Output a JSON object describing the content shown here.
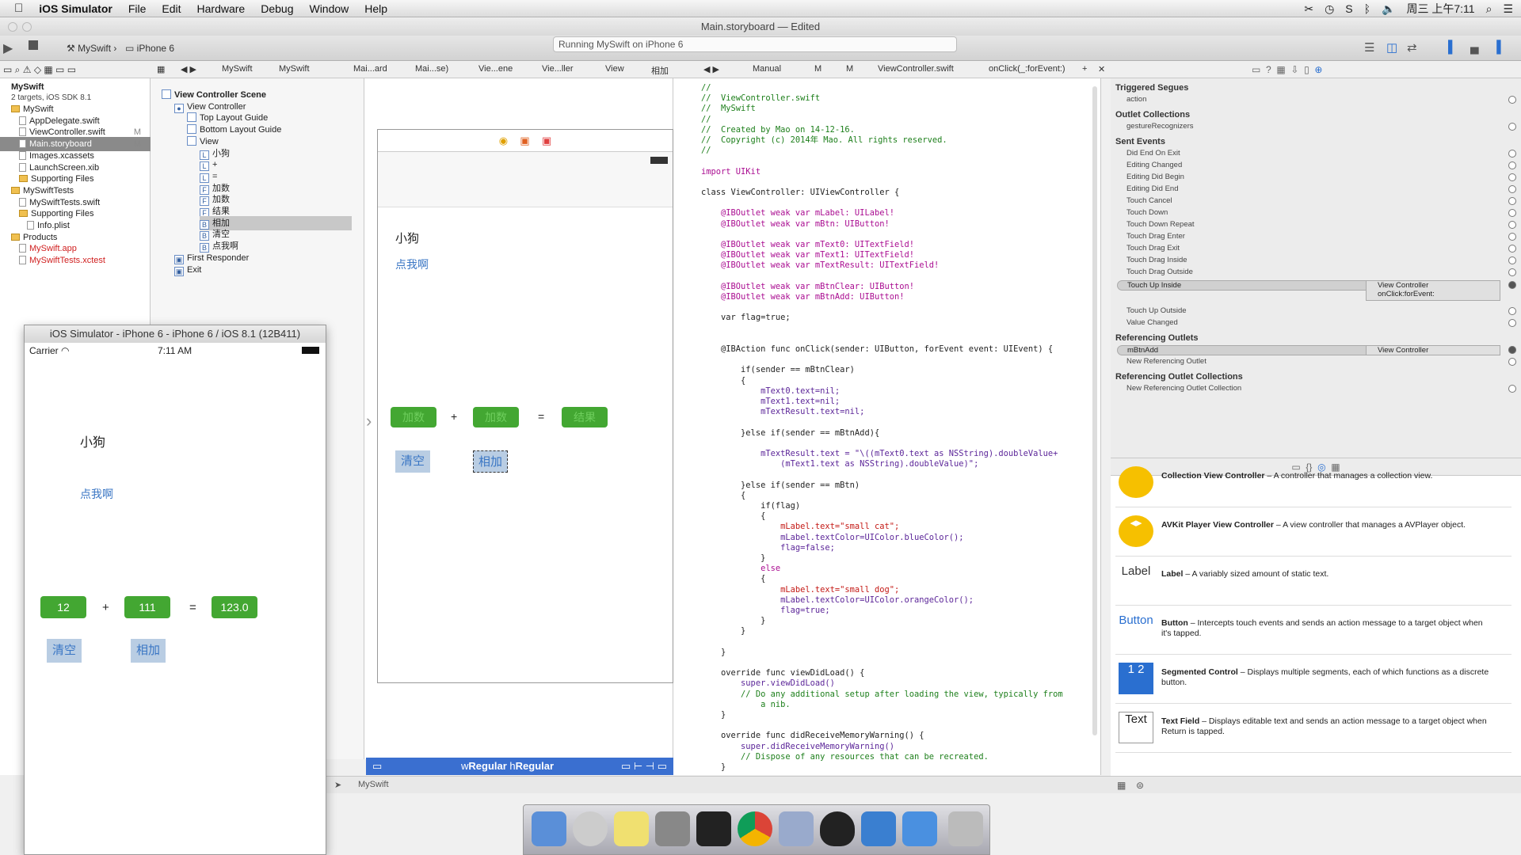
{
  "menubar": {
    "app": "iOS Simulator",
    "items": [
      "File",
      "Edit",
      "Hardware",
      "Debug",
      "Window",
      "Help"
    ],
    "clock": "周三 上午7:11"
  },
  "window": {
    "title": "Main.storyboard — Edited"
  },
  "toolbar": {
    "scheme": "MySwift",
    "device": "iPhone 6",
    "activity": "Running MySwift on iPhone 6"
  },
  "jumpbar": {
    "left": [
      "MySwift",
      "MySwift",
      "Mai...ard",
      "Mai...se)",
      "Vie...ene",
      "Vie...ller",
      "View",
      "相加"
    ],
    "right": [
      "Manual",
      "M",
      "M",
      "ViewController.swift",
      "onClick(_:forEvent:)"
    ]
  },
  "navigator": {
    "project": "MySwift",
    "project_sub": "2 targets, iOS SDK 8.1",
    "items": [
      {
        "label": "MySwift",
        "type": "folder",
        "indent": 1
      },
      {
        "label": "AppDelegate.swift",
        "type": "file",
        "indent": 2
      },
      {
        "label": "ViewController.swift",
        "type": "file",
        "indent": 2,
        "badge": "M"
      },
      {
        "label": "Main.storyboard",
        "type": "file",
        "indent": 2,
        "badge": "M",
        "selected": true
      },
      {
        "label": "Images.xcassets",
        "type": "file",
        "indent": 2
      },
      {
        "label": "LaunchScreen.xib",
        "type": "file",
        "indent": 2
      },
      {
        "label": "Supporting Files",
        "type": "folder",
        "indent": 2
      },
      {
        "label": "MySwiftTests",
        "type": "folder",
        "indent": 1
      },
      {
        "label": "MySwiftTests.swift",
        "type": "file",
        "indent": 2
      },
      {
        "label": "Supporting Files",
        "type": "folder",
        "indent": 2
      },
      {
        "label": "Info.plist",
        "type": "file",
        "indent": 3
      },
      {
        "label": "Products",
        "type": "folder",
        "indent": 1
      },
      {
        "label": "MySwift.app",
        "type": "file",
        "indent": 2,
        "red": true
      },
      {
        "label": "MySwiftTests.xctest",
        "type": "file",
        "indent": 2,
        "red": true
      }
    ],
    "filter": "MySwift"
  },
  "outline": {
    "items": [
      {
        "label": "View Controller Scene",
        "indent": 0,
        "bold": true,
        "icon": ""
      },
      {
        "label": "View Controller",
        "indent": 1,
        "icon": "●"
      },
      {
        "label": "Top Layout Guide",
        "indent": 2,
        "icon": ""
      },
      {
        "label": "Bottom Layout Guide",
        "indent": 2,
        "icon": ""
      },
      {
        "label": "View",
        "indent": 2,
        "icon": ""
      },
      {
        "label": "小狗",
        "indent": 3,
        "icon": "L"
      },
      {
        "label": "+",
        "indent": 3,
        "icon": "L"
      },
      {
        "label": "=",
        "indent": 3,
        "icon": "L"
      },
      {
        "label": "加数",
        "indent": 3,
        "icon": "F"
      },
      {
        "label": "加数",
        "indent": 3,
        "icon": "F"
      },
      {
        "label": "结果",
        "indent": 3,
        "icon": "F"
      },
      {
        "label": "相加",
        "indent": 3,
        "icon": "B",
        "selected": true
      },
      {
        "label": "清空",
        "indent": 3,
        "icon": "B"
      },
      {
        "label": "点我啊",
        "indent": 3,
        "icon": "B"
      },
      {
        "label": "First Responder",
        "indent": 1,
        "icon": "▣"
      },
      {
        "label": "Exit",
        "indent": 1,
        "icon": "▣"
      }
    ]
  },
  "storyboard": {
    "label": "小狗",
    "button": "点我啊",
    "field1": "加数",
    "plus": "+",
    "field2": "加数",
    "equals": "=",
    "field3": "结果",
    "clear": "清空",
    "add": "相加",
    "size_class": "wRegular hRegular",
    "w": "w",
    "h": "h",
    "size_w": "Regular",
    "size_h": "Regular"
  },
  "code": [
    {
      "t": "//",
      "c": "cm"
    },
    {
      "t": "//  ViewController.swift",
      "c": "cm"
    },
    {
      "t": "//  MySwift",
      "c": "cm"
    },
    {
      "t": "//",
      "c": "cm"
    },
    {
      "t": "//  Created by Mao on 14-12-16.",
      "c": "cm"
    },
    {
      "t": "//  Copyright (c) 2014年 Mao. All rights reserved.",
      "c": "cm"
    },
    {
      "t": "//",
      "c": "cm"
    },
    {
      "t": "",
      "c": ""
    },
    {
      "t": "import UIKit",
      "c": "kw"
    },
    {
      "t": "",
      "c": ""
    },
    {
      "t": "class ViewController: UIViewController {",
      "c": ""
    },
    {
      "t": "",
      "c": ""
    },
    {
      "t": "    @IBOutlet weak var mLabel: UILabel!",
      "c": "kw"
    },
    {
      "t": "    @IBOutlet weak var mBtn: UIButton!",
      "c": "kw"
    },
    {
      "t": "",
      "c": ""
    },
    {
      "t": "    @IBOutlet weak var mText0: UITextField!",
      "c": "kw"
    },
    {
      "t": "    @IBOutlet weak var mText1: UITextField!",
      "c": "kw"
    },
    {
      "t": "    @IBOutlet weak var mTextResult: UITextField!",
      "c": "kw"
    },
    {
      "t": "",
      "c": ""
    },
    {
      "t": "    @IBOutlet weak var mBtnClear: UIButton!",
      "c": "kw"
    },
    {
      "t": "    @IBOutlet weak var mBtnAdd: UIButton!",
      "c": "kw"
    },
    {
      "t": "",
      "c": ""
    },
    {
      "t": "    var flag=true;",
      "c": ""
    },
    {
      "t": "",
      "c": ""
    },
    {
      "t": "",
      "c": ""
    },
    {
      "t": "    @IBAction func onClick(sender: UIButton, forEvent event: UIEvent) {",
      "c": ""
    },
    {
      "t": "",
      "c": ""
    },
    {
      "t": "        if(sender == mBtnClear)",
      "c": ""
    },
    {
      "t": "        {",
      "c": ""
    },
    {
      "t": "            mText0.text=nil;",
      "c": "ty"
    },
    {
      "t": "            mText1.text=nil;",
      "c": "ty"
    },
    {
      "t": "            mTextResult.text=nil;",
      "c": "ty"
    },
    {
      "t": "",
      "c": ""
    },
    {
      "t": "        }else if(sender == mBtnAdd){",
      "c": ""
    },
    {
      "t": "",
      "c": ""
    },
    {
      "t": "            mTextResult.text = \"\\((mText0.text as NSString).doubleValue+",
      "c": "ty"
    },
    {
      "t": "                (mText1.text as NSString).doubleValue)\";",
      "c": "ty"
    },
    {
      "t": "",
      "c": ""
    },
    {
      "t": "        }else if(sender == mBtn)",
      "c": ""
    },
    {
      "t": "        {",
      "c": ""
    },
    {
      "t": "            if(flag)",
      "c": ""
    },
    {
      "t": "            {",
      "c": ""
    },
    {
      "t": "                mLabel.text=\"small cat\";",
      "c": "st"
    },
    {
      "t": "                mLabel.textColor=UIColor.blueColor();",
      "c": "ty"
    },
    {
      "t": "                flag=false;",
      "c": "ty"
    },
    {
      "t": "            }",
      "c": ""
    },
    {
      "t": "            else",
      "c": "kw"
    },
    {
      "t": "            {",
      "c": ""
    },
    {
      "t": "                mLabel.text=\"small dog\";",
      "c": "st"
    },
    {
      "t": "                mLabel.textColor=UIColor.orangeColor();",
      "c": "ty"
    },
    {
      "t": "                flag=true;",
      "c": "ty"
    },
    {
      "t": "            }",
      "c": ""
    },
    {
      "t": "        }",
      "c": ""
    },
    {
      "t": "",
      "c": ""
    },
    {
      "t": "    }",
      "c": ""
    },
    {
      "t": "",
      "c": ""
    },
    {
      "t": "    override func viewDidLoad() {",
      "c": ""
    },
    {
      "t": "        super.viewDidLoad()",
      "c": "ty"
    },
    {
      "t": "        // Do any additional setup after loading the view, typically from",
      "c": "cm"
    },
    {
      "t": "            a nib.",
      "c": "cm"
    },
    {
      "t": "    }",
      "c": ""
    },
    {
      "t": "",
      "c": ""
    },
    {
      "t": "    override func didReceiveMemoryWarning() {",
      "c": ""
    },
    {
      "t": "        super.didReceiveMemoryWarning()",
      "c": "ty"
    },
    {
      "t": "        // Dispose of any resources that can be recreated.",
      "c": "cm"
    },
    {
      "t": "    }",
      "c": ""
    }
  ],
  "inspector": {
    "sections": [
      {
        "title": "Triggered Segues",
        "rows": [
          "action"
        ]
      },
      {
        "title": "Outlet Collections",
        "rows": [
          "gestureRecognizers"
        ]
      },
      {
        "title": "Sent Events",
        "rows": [
          "Did End On Exit",
          "Editing Changed",
          "Editing Did Begin",
          "Editing Did End",
          "Touch Cancel",
          "Touch Down",
          "Touch Down Repeat",
          "Touch Drag Enter",
          "Touch Drag Exit",
          "Touch Drag Inside",
          "Touch Drag Outside"
        ]
      },
      {
        "title": "",
        "rows": [
          "Touch Up Outside",
          "Value Changed"
        ]
      },
      {
        "title": "Referencing Outlets",
        "rows": [
          "New Referencing Outlet"
        ]
      },
      {
        "title": "Referencing Outlet Collections",
        "rows": [
          "New Referencing Outlet Collection"
        ]
      }
    ],
    "touchupinside": "Touch Up Inside",
    "tui_target": "View Controller",
    "tui_action": "onClick:forEvent:",
    "refoutlet": "mBtnAdd",
    "ref_target": "View Controller"
  },
  "library": [
    {
      "name": "Collection View Controller",
      "desc": " – A controller that manages a collection view.",
      "icon": ""
    },
    {
      "name": "AVKit Player View Controller",
      "desc": " – A view controller that manages a AVPlayer object.",
      "icon": "◂▸"
    },
    {
      "name": "Label",
      "desc": " – A variably sized amount of static text.",
      "icon": "Label"
    },
    {
      "name": "Button",
      "desc": " – Intercepts touch events and sends an action message to a target object when it's tapped.",
      "icon": "Button"
    },
    {
      "name": "Segmented Control",
      "desc": " – Displays multiple segments, each of which functions as a discrete button.",
      "icon": "1 2"
    },
    {
      "name": "Text Field",
      "desc": " – Displays editable text and sends an action message to a target object when Return is tapped.",
      "icon": "Text"
    }
  ],
  "simulator": {
    "title": "iOS Simulator - iPhone 6 - iPhone 6 / iOS 8.1 (12B411)",
    "carrier": "Carrier",
    "time": "7:11 AM",
    "label": "小狗",
    "button": "点我啊",
    "field1": "12",
    "plus": "+",
    "field2": "111",
    "equals": "=",
    "result": "123.0",
    "clear": "清空",
    "add": "相加"
  },
  "colors": {
    "green": "#43a732",
    "blue_text": "#3a76c4",
    "button_bg": "#b9cde3"
  }
}
